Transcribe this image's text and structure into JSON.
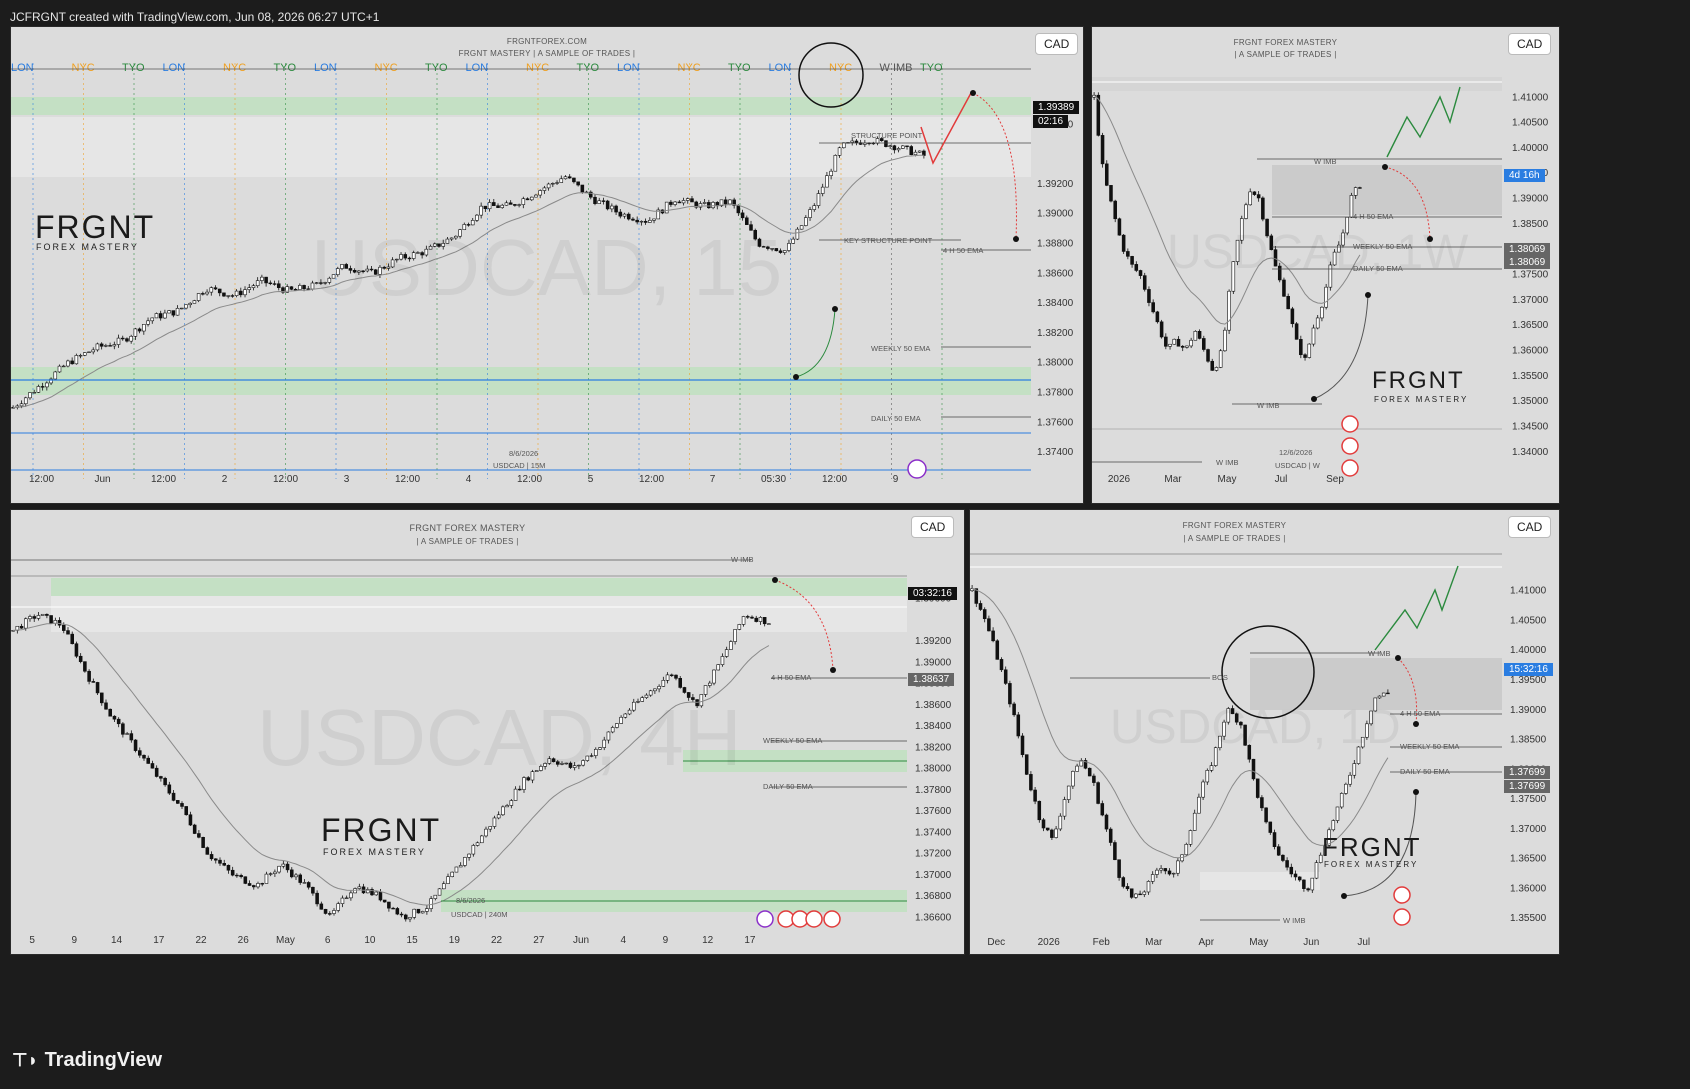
{
  "header": {
    "text": "JCFRGNT created with TradingView.com, Jun 08, 2026 06:27 UTC+1"
  },
  "footer": {
    "brand": "TradingView",
    "brand_icon": "tradingview-logo-icon"
  },
  "colors": {
    "background": "#1c1c1c",
    "panel": "#dcdcdc",
    "zone_green": "#bfe0c0",
    "path_red": "#e23b3b",
    "path_green": "#2b8a3e",
    "blue_line": "#2a7de1"
  },
  "logo": {
    "big": "FRGNT",
    "small": "FOREX MASTERY"
  },
  "panels": {
    "m15": {
      "currency": "CAD",
      "header_line1": "FRGNTFOREX.COM",
      "header_line2": "FRGNT MASTERY | A SAMPLE OF TRADES |",
      "watermark": "USDCAD, 15",
      "footer_line1": "8/6/2026",
      "footer_line2": "USDCAD | 15M",
      "price_label": "1.39389",
      "countdown": "02:16",
      "annotations": {
        "w_imb": "W IMB",
        "structure_point": "STRUCTURE POINT",
        "key_structure": "KEY STRUCTURE POINT",
        "ema_4h": "4 H 50 EMA",
        "ema_weekly": "WEEKLY 50 EMA",
        "ema_daily": "DAILY 50 EMA"
      },
      "sessions": [
        "LON",
        "NYC",
        "TYO",
        "LON",
        "NYC",
        "TYO",
        "LON",
        "NYC",
        "TYO",
        "LON",
        "NYC",
        "TYO",
        "LON",
        "NYC",
        "TYO",
        "LON",
        "NYC",
        "W IMB",
        "TYO"
      ]
    },
    "weekly": {
      "currency": "CAD",
      "header_line1": "FRGNT FOREX MASTERY",
      "header_line2": "| A SAMPLE OF TRADES |",
      "watermark": "USDCAD, 1W",
      "footer_line1": "12/6/2026",
      "footer_line2": "USDCAD | W",
      "price_label_1": "4d 16h",
      "price_label_2": "1.38069",
      "price_label_3": "1.38069",
      "annotations": {
        "w_imb_top": "W IMB",
        "ema_4h": "4 H 50 EMA",
        "ema_weekly": "WEEKLY 50 EMA",
        "ema_daily": "DAILY 50 EMA",
        "w_imb_bottom": "W IMB",
        "w_imb_left": "W IMB"
      }
    },
    "h4": {
      "currency": "CAD",
      "header_line1": "FRGNT FOREX MASTERY",
      "header_line2": "| A SAMPLE OF TRADES |",
      "watermark": "USDCAD, 4H",
      "footer_line1": "8/6/2026",
      "footer_line2": "USDCAD | 240M",
      "price_label_1": "03:32:16",
      "price_label_2": "1.38637",
      "annotations": {
        "w_imb": "W IMB",
        "ema_4h": "4 H 50 EMA",
        "ema_weekly": "WEEKLY 50 EMA",
        "ema_daily": "DAILY 50 EMA"
      }
    },
    "daily": {
      "currency": "CAD",
      "header_line1": "FRGNT FOREX MASTERY",
      "header_line2": "| A SAMPLE OF TRADES |",
      "watermark": "USDCAD, 1D",
      "price_label_1": "15:32:16",
      "price_label_2": "1.37699",
      "price_label_3": "1.37699",
      "annotations": {
        "w_imb_top": "W IMB",
        "bos": "BOS",
        "ema_4h": "4 H 50 EMA",
        "ema_weekly": "WEEKLY 50 EMA",
        "ema_daily": "DAILY 50 EMA",
        "w_imb_bottom": "W IMB"
      }
    }
  },
  "chart_data": [
    {
      "type": "candlestick",
      "title": "USDCAD, 15",
      "x_ticks": [
        "12:00",
        "Jun",
        "12:00",
        "2",
        "12:00",
        "3",
        "12:00",
        "4",
        "12:00",
        "5",
        "12:00",
        "7",
        "05:30",
        "12:00",
        "9"
      ],
      "y_ticks": [
        "1.39600",
        "1.39200",
        "1.39000",
        "1.38800",
        "1.38600",
        "1.38400",
        "1.38200",
        "1.38000",
        "1.37800",
        "1.37600",
        "1.37400"
      ],
      "ylim": [
        1.373,
        1.3985
      ],
      "close_path": [
        1.377,
        1.3785,
        1.38,
        1.381,
        1.3815,
        1.383,
        1.3835,
        1.385,
        1.3845,
        1.3855,
        1.3848,
        1.3852,
        1.3865,
        1.386,
        1.387,
        1.3875,
        1.3885,
        1.3905,
        1.3905,
        1.3915,
        1.3925,
        1.391,
        1.39,
        1.3895,
        1.391,
        1.3905,
        1.3908,
        1.388,
        1.3875,
        1.3905,
        1.3945,
        1.395,
        1.3945,
        1.3939
      ]
    },
    {
      "type": "candlestick",
      "title": "USDCAD, 1W",
      "x_ticks": [
        "2026",
        "Mar",
        "May",
        "Jul",
        "Sep"
      ],
      "y_ticks": [
        "1.41000",
        "1.40500",
        "1.40000",
        "1.39500",
        "1.39000",
        "1.38500",
        "1.38000",
        "1.37500",
        "1.37000",
        "1.36500",
        "1.36000",
        "1.35500",
        "1.35000",
        "1.34500",
        "1.34000"
      ],
      "ylim": [
        1.337,
        1.414
      ],
      "close_path": [
        1.41,
        1.395,
        1.388,
        1.381,
        1.377,
        1.375,
        1.37,
        1.365,
        1.36,
        1.362,
        1.36,
        1.364,
        1.36,
        1.356,
        1.36,
        1.375,
        1.385,
        1.392,
        1.39,
        1.382,
        1.375,
        1.37,
        1.362,
        1.358,
        1.365,
        1.37,
        1.378,
        1.382,
        1.39,
        1.3927
      ]
    },
    {
      "type": "candlestick",
      "title": "USDCAD, 4H",
      "x_ticks": [
        "5",
        "9",
        "14",
        "17",
        "22",
        "26",
        "May",
        "6",
        "10",
        "15",
        "19",
        "22",
        "27",
        "Jun",
        "4",
        "9",
        "12",
        "17"
      ],
      "y_ticks": [
        "1.39600",
        "1.39200",
        "1.39000",
        "1.38800",
        "1.38600",
        "1.38400",
        "1.38200",
        "1.38000",
        "1.37800",
        "1.37600",
        "1.37400",
        "1.37200",
        "1.37000",
        "1.36800",
        "1.36600"
      ],
      "ylim": [
        1.365,
        1.3985
      ],
      "close_path": [
        1.393,
        1.3945,
        1.3935,
        1.389,
        1.385,
        1.382,
        1.379,
        1.376,
        1.372,
        1.37,
        1.369,
        1.371,
        1.369,
        1.366,
        1.369,
        1.368,
        1.366,
        1.367,
        1.37,
        1.373,
        1.376,
        1.379,
        1.381,
        1.38,
        1.382,
        1.385,
        1.387,
        1.389,
        1.386,
        1.39,
        1.3945,
        1.3938
      ]
    },
    {
      "type": "candlestick",
      "title": "USDCAD, 1D",
      "x_ticks": [
        "Dec",
        "2026",
        "Feb",
        "Mar",
        "Apr",
        "May",
        "Jun",
        "Jul"
      ],
      "y_ticks": [
        "1.41000",
        "1.40500",
        "1.40000",
        "1.39500",
        "1.39000",
        "1.38500",
        "1.38000",
        "1.37500",
        "1.37000",
        "1.36500",
        "1.36000",
        "1.35500"
      ],
      "ylim": [
        1.353,
        1.416
      ],
      "close_path": [
        1.41,
        1.405,
        1.398,
        1.39,
        1.38,
        1.372,
        1.368,
        1.376,
        1.382,
        1.378,
        1.37,
        1.362,
        1.358,
        1.36,
        1.364,
        1.362,
        1.368,
        1.376,
        1.382,
        1.39,
        1.388,
        1.378,
        1.37,
        1.365,
        1.362,
        1.36,
        1.366,
        1.372,
        1.378,
        1.385,
        1.392,
        1.3928
      ]
    }
  ]
}
